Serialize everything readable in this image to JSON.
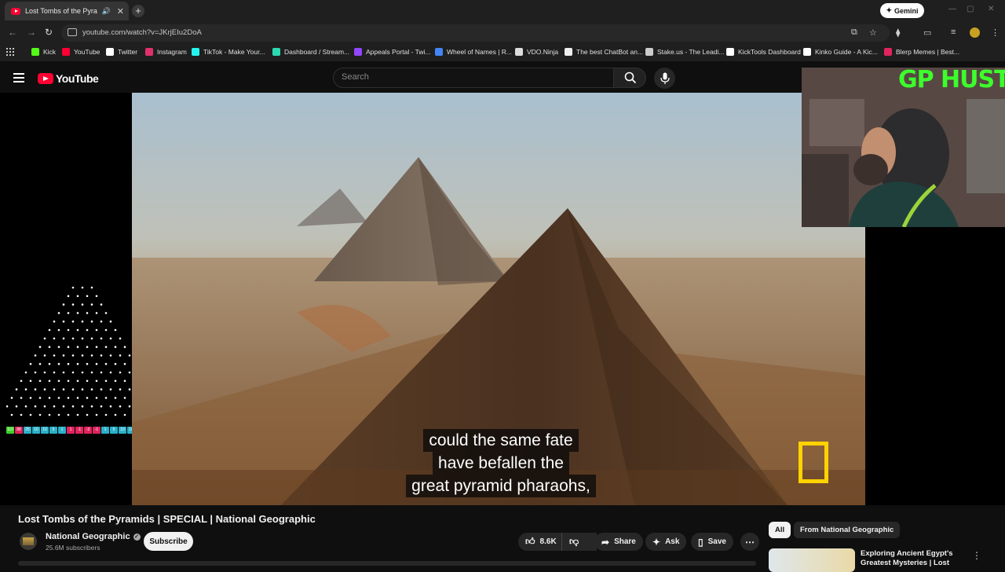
{
  "browser": {
    "tab_title": "Lost Tombs of the Pyramids | SPECIAL | National Geographic",
    "url": "youtube.com/watch?v=JKrjEIu2DoA",
    "gemini_label": "Gemini",
    "bookmarks": [
      {
        "label": "Kick",
        "color": "#53fc18"
      },
      {
        "label": "YouTube",
        "color": "#ff0033"
      },
      {
        "label": "Twitter",
        "color": "#ffffff"
      },
      {
        "label": "Instagram",
        "color": "#e1306c"
      },
      {
        "label": "TikTok - Make Your...",
        "color": "#25f4ee"
      },
      {
        "label": "Dashboard / Stream...",
        "color": "#2bd9b0"
      },
      {
        "label": "Appeals Portal - Twi...",
        "color": "#9146ff"
      },
      {
        "label": "Wheel of Names | R...",
        "color": "#4285f4"
      },
      {
        "label": "VDO.Ninja",
        "color": "#dddddd"
      },
      {
        "label": "The best ChatBot an...",
        "color": "#eeeeee"
      },
      {
        "label": "Stake.us - The Leadi...",
        "color": "#cccccc"
      },
      {
        "label": "KickTools Dashboard",
        "color": "#ffffff"
      },
      {
        "label": "Kinko Guide - A Kic...",
        "color": "#ffffff"
      },
      {
        "label": "Blerp Memes | Best...",
        "color": "#e0245e"
      }
    ]
  },
  "youtube": {
    "logo_text": "YouTube",
    "search_placeholder": "Search",
    "caption_lines": [
      "could the same fate",
      "have befallen the",
      "great pyramid pharaohs,"
    ],
    "overlay_title": "GP HUSTLA",
    "plinko_slots": [
      {
        "label": "110",
        "color": "#3ecf2a"
      },
      {
        "label": "88",
        "color": "#e0245e"
      },
      {
        "label": "25",
        "color": "#2bb0c9"
      },
      {
        "label": "10",
        "color": "#2bb0c9"
      },
      {
        "label": "10",
        "color": "#2bb0c9"
      },
      {
        "label": "5",
        "color": "#2bb0c9"
      },
      {
        "label": "1",
        "color": "#2bb0c9"
      },
      {
        "label": "1",
        "color": "#e0245e"
      },
      {
        "label": "-1",
        "color": "#e0245e"
      },
      {
        "label": "-3",
        "color": "#e0245e"
      },
      {
        "label": "-1",
        "color": "#e0245e"
      },
      {
        "label": "1",
        "color": "#2bb0c9"
      },
      {
        "label": "5",
        "color": "#2bb0c9"
      },
      {
        "label": "10",
        "color": "#2bb0c9"
      },
      {
        "label": "10",
        "color": "#2bb0c9"
      },
      {
        "label": "25",
        "color": "#2bb0c9"
      },
      {
        "label": "58",
        "color": "#2bb0c9"
      },
      {
        "label": "110",
        "color": "#3ecf2a"
      }
    ],
    "video_title": "Lost Tombs of the Pyramids | SPECIAL | National Geographic",
    "channel_name": "National Geographic",
    "subscribers": "25.6M subscribers",
    "subscribe_label": "Subscribe",
    "like_count": "8.6K",
    "share_label": "Share",
    "ask_label": "Ask",
    "save_label": "Save",
    "chips": [
      "All",
      "From National Geographic"
    ],
    "recommendation_title": "Exploring Ancient Egypt's Greatest Mysteries | Lost"
  }
}
